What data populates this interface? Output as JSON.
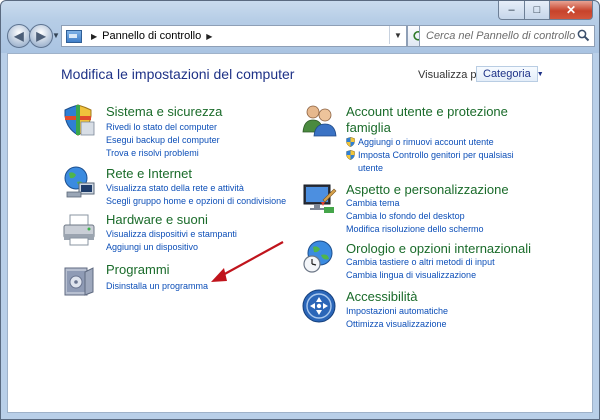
{
  "window": {
    "buttons": {
      "minimize": "–",
      "maximize": "□",
      "close": "✕"
    }
  },
  "navigation": {
    "address": "Pannello di controllo",
    "search_placeholder": "Cerca nel Pannello di controllo"
  },
  "header": {
    "title": "Modifica le impostazioni del computer",
    "view_label": "Visualizza per:",
    "view_value": "Categoria"
  },
  "categories": {
    "sistema": {
      "title": "Sistema e sicurezza",
      "icon": "shield-icon",
      "links": [
        "Rivedi lo stato del computer",
        "Esegui backup del computer",
        "Trova e risolvi problemi"
      ]
    },
    "rete": {
      "title": "Rete e Internet",
      "icon": "globe-network-icon",
      "links": [
        "Visualizza stato della rete e attività",
        "Scegli gruppo home e opzioni di condivisione"
      ]
    },
    "hardware": {
      "title": "Hardware e suoni",
      "icon": "printer-icon",
      "links": [
        "Visualizza dispositivi e stampanti",
        "Aggiungi un dispositivo"
      ]
    },
    "programmi": {
      "title": "Programmi",
      "icon": "programs-box-icon",
      "links": [
        "Disinstalla un programma"
      ]
    },
    "account": {
      "title_line1": "Account utente e protezione",
      "title_line2": "famiglia",
      "icon": "users-icon",
      "links": [
        "Aggiungi o rimuovi account utente",
        "Imposta Controllo genitori per qualsiasi",
        "utente"
      ]
    },
    "aspetto": {
      "title": "Aspetto e personalizzazione",
      "icon": "monitor-paint-icon",
      "links": [
        "Cambia tema",
        "Cambia lo sfondo del desktop",
        "Modifica risoluzione dello schermo"
      ]
    },
    "orologio": {
      "title": "Orologio e opzioni internazionali",
      "icon": "clock-globe-icon",
      "links": [
        "Cambia tastiere o altri metodi di input",
        "Cambia lingua di visualizzazione"
      ]
    },
    "accessibilita": {
      "title": "Accessibilità",
      "icon": "accessibility-icon",
      "links": [
        "Impostazioni automatiche",
        "Ottimizza visualizzazione"
      ]
    }
  },
  "colors": {
    "category_title": "#1a6b2a",
    "link": "#0d4fb8",
    "heading": "#1e3287",
    "annotation_arrow": "#c0141c"
  }
}
